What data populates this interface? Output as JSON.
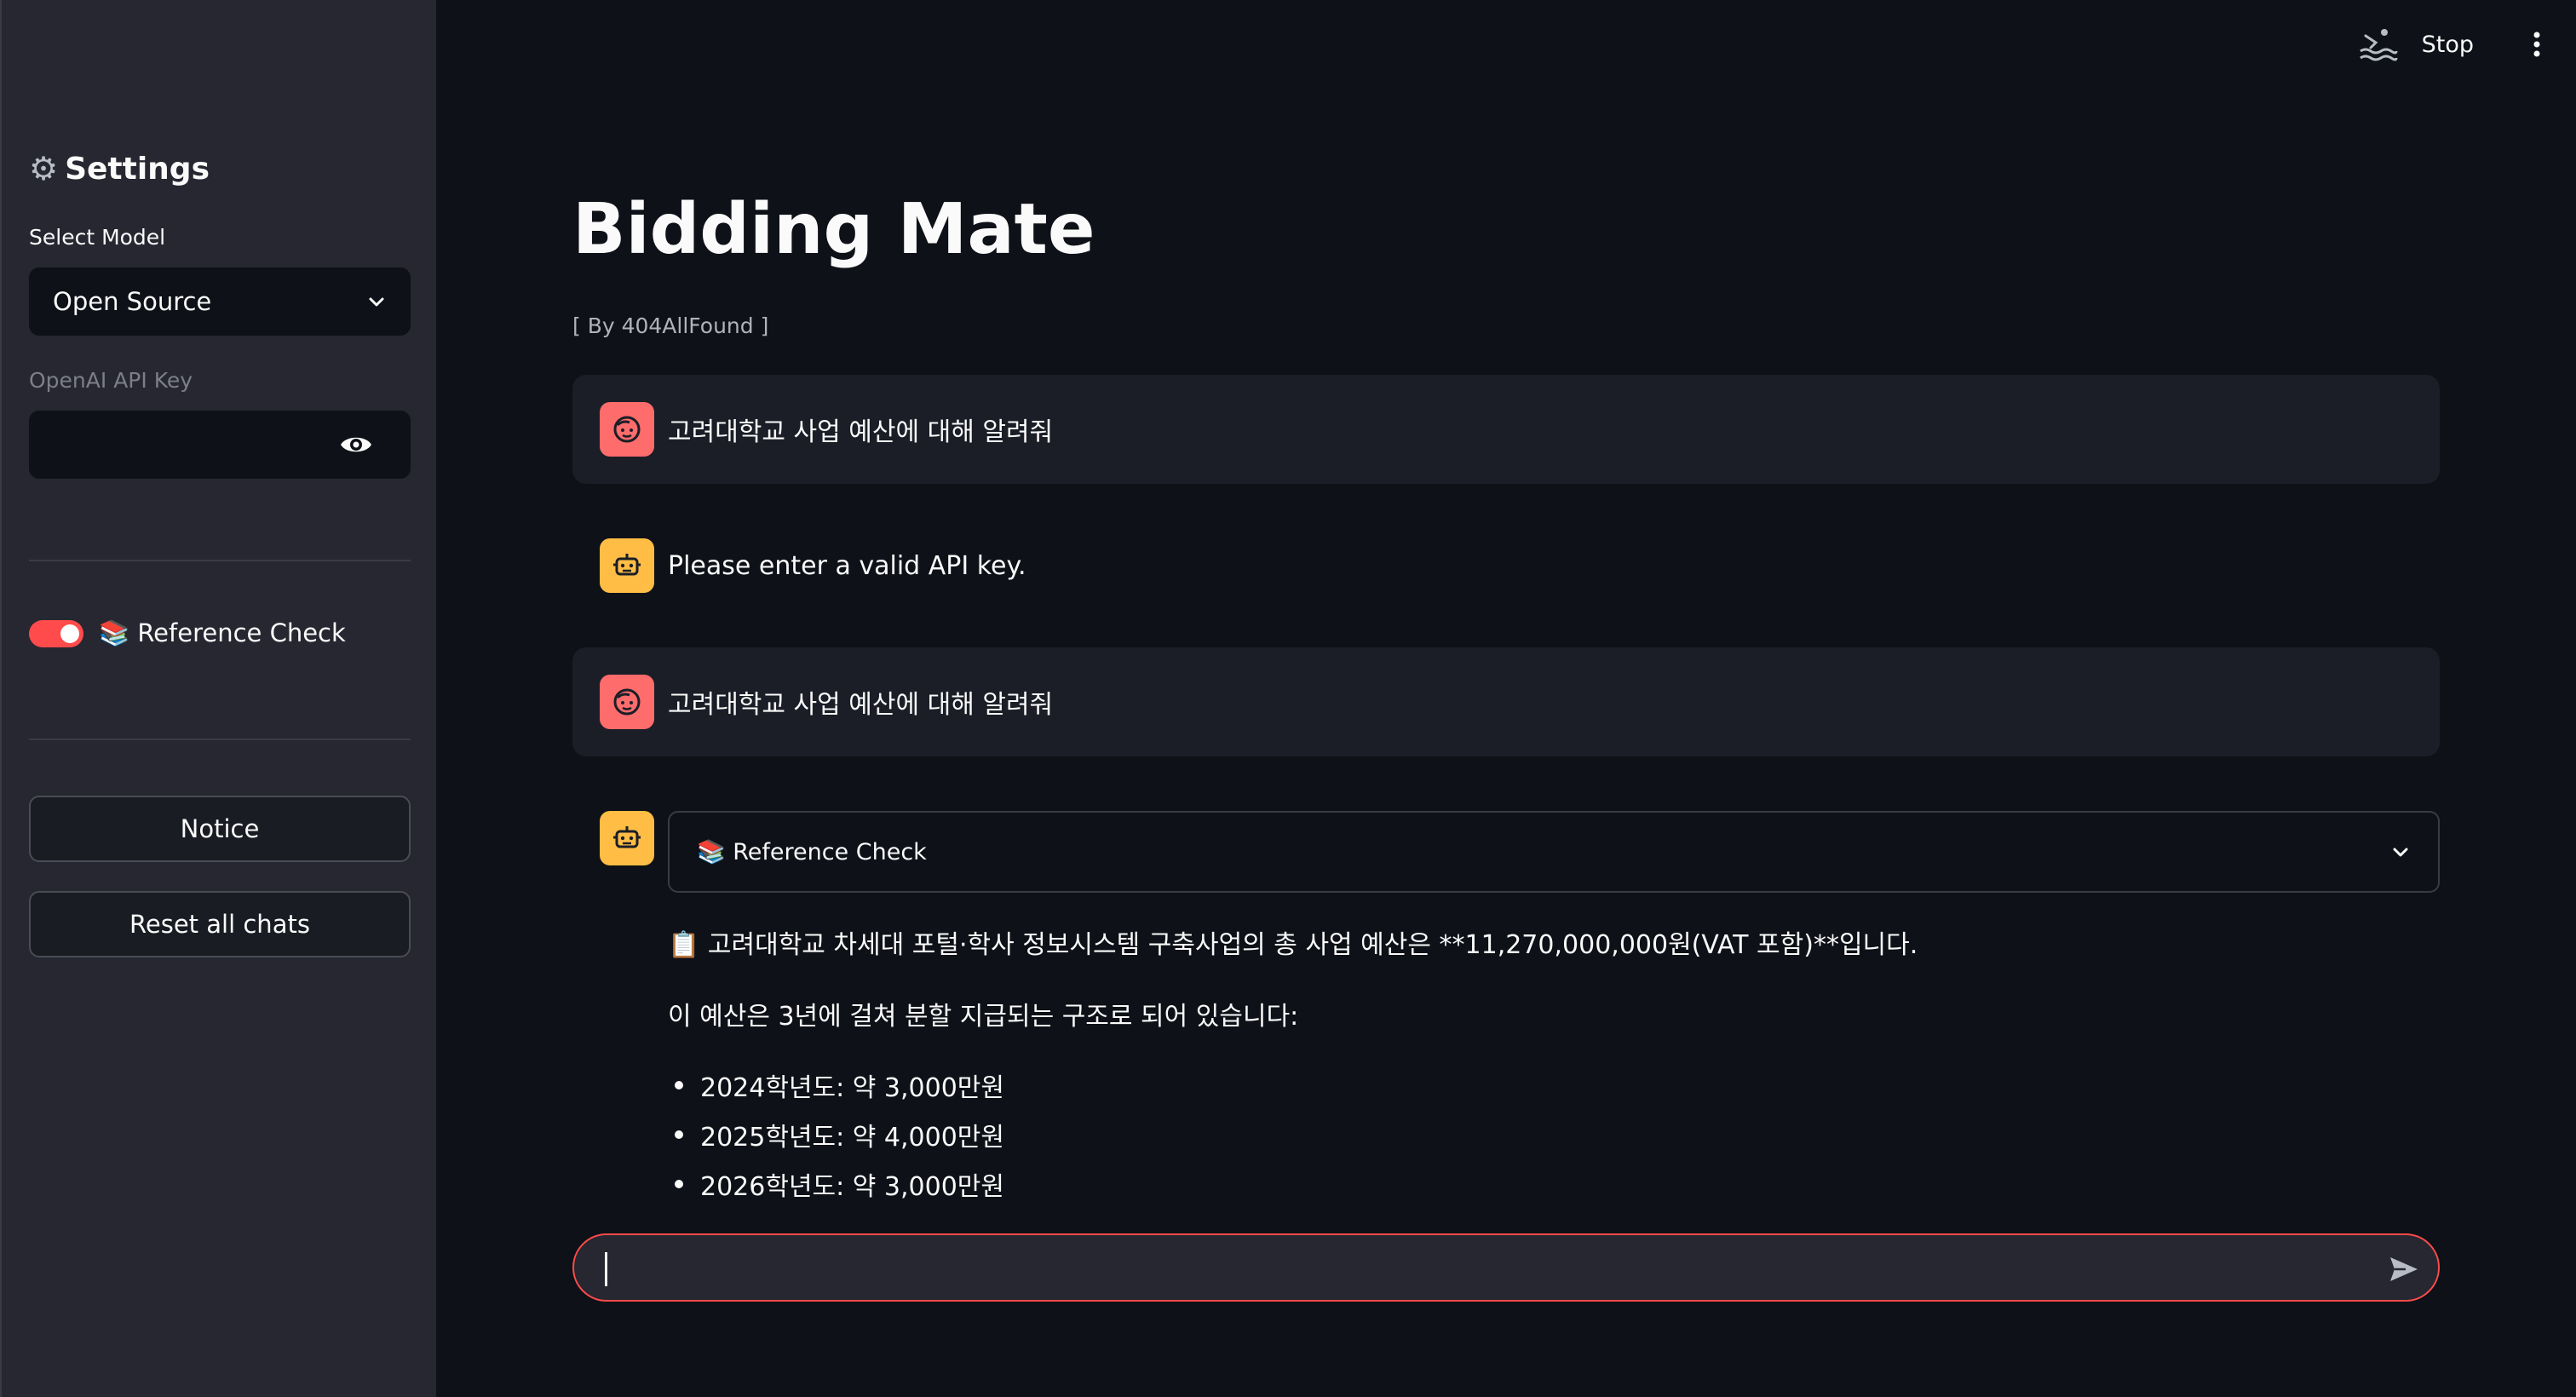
{
  "sidebar": {
    "title": "Settings",
    "select_model_label": "Select Model",
    "select_model_value": "Open Source",
    "api_key_label": "OpenAI API Key",
    "api_key_value": "",
    "reference_toggle": {
      "label": "📚 Reference Check",
      "on": true
    },
    "notice_button": "Notice",
    "reset_button": "Reset all chats"
  },
  "toolbar": {
    "stop_label": "Stop"
  },
  "main": {
    "title": "Bidding Mate",
    "byline": "[ By 404AllFound ]",
    "messages": [
      {
        "role": "user",
        "text": "고려대학교 사업 예산에 대해 알려줘"
      },
      {
        "role": "assistant",
        "text": "Please enter a valid API key."
      },
      {
        "role": "user",
        "text": "고려대학교 사업 예산에 대해 알려줘"
      }
    ],
    "answer": {
      "expander_label": "📚 Reference Check",
      "line1": "📋 고려대학교 차세대 포털·학사 정보시스템 구축사업의 총 사업 예산은 **11,270,000,000원(VAT 포함)**입니다.",
      "line2": "이 예산은 3년에 걸쳐 분할 지급되는 구조로 되어 있습니다:",
      "bullets": [
        "2024학년도: 약 3,000만원",
        "2025학년도: 약 4,000만원",
        "2026학년도: 약 3,000만원"
      ]
    },
    "chat_input_value": ""
  },
  "colors": {
    "accent": "#ff4b4b",
    "user_avatar": "#ff6c6c",
    "bot_avatar": "#ffbd45",
    "background": "#0e1117",
    "sidebar": "#262730"
  }
}
